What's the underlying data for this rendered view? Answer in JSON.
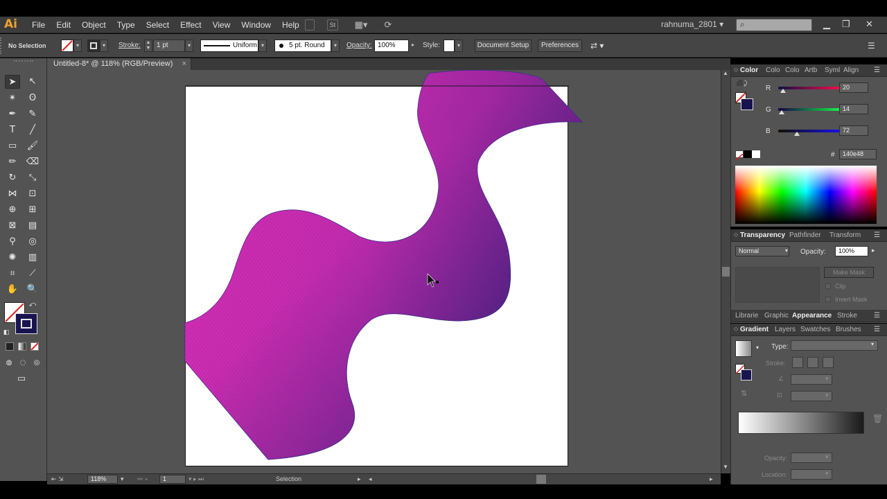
{
  "app": {
    "logo": "Ai",
    "user": "rahnuma_2801",
    "menu": [
      "File",
      "Edit",
      "Object",
      "Type",
      "Select",
      "Effect",
      "View",
      "Window",
      "Help"
    ],
    "st_label": "St"
  },
  "control_bar": {
    "selection_status": "No Selection",
    "stroke_label": "Stroke:",
    "stroke_weight": "1 pt",
    "profile": "Uniform",
    "brush": "5 pt. Round",
    "opacity_label": "Opacity:",
    "opacity": "100%",
    "style_label": "Style:",
    "document_setup": "Document Setup",
    "preferences": "Preferences"
  },
  "document": {
    "tab_title": "Untitled-8* @ 118% (RGB/Preview)"
  },
  "status_bar": {
    "zoom": "118%",
    "page": "1",
    "mode": "Selection"
  },
  "color_panel": {
    "tabs": [
      "Color",
      "Colo",
      "Colo",
      "Artb",
      "Syml",
      "Align"
    ],
    "r_label": "R",
    "r_value": "20",
    "g_label": "G",
    "g_value": "14",
    "b_label": "B",
    "b_value": "72",
    "r": 20,
    "g": 14,
    "b": 72,
    "hex_label": "#",
    "hex": "140e48"
  },
  "transparency_panel": {
    "tabs": [
      "Transparency",
      "Pathfinder",
      "Transform"
    ],
    "blend_mode": "Normal",
    "opacity_label": "Opacity:",
    "opacity": "100%",
    "make_mask": "Make Mask",
    "clip": "Clip",
    "invert_mask": "Invert Mask"
  },
  "appearance_tabs": [
    "Librarie",
    "Graphic",
    "Appearance",
    "Stroke"
  ],
  "gradient_panel": {
    "tabs": [
      "Gradient",
      "Layers",
      "Swatches",
      "Brushes"
    ],
    "type_label": "Type:",
    "stroke_label": "Stroke:",
    "opacity_label": "Opacity:",
    "location_label": "Location:"
  },
  "colors": {
    "wave_magenta": "#d62bb0",
    "wave_navy": "#1e1c6e",
    "panel_bg": "#535353",
    "accent": "#e8a040"
  }
}
